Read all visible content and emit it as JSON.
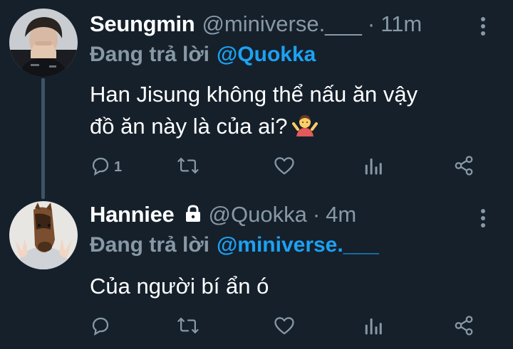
{
  "tweets": [
    {
      "display_name": "Seungmin",
      "handle": "@miniverse.___",
      "separator": "·",
      "time": "11m",
      "reply_prefix": "Đang trả lời",
      "reply_to": "@Quokka",
      "body_line1": "Han Jisung không thể nấu ăn vậy",
      "body_line2": "đồ ăn này là của ai?",
      "emoji": "person-shrugging-emoji",
      "reply_count": "1",
      "protected": false
    },
    {
      "display_name": "Hanniee",
      "handle": "@Quokka",
      "separator": "·",
      "time": "4m",
      "reply_prefix": "Đang trả lời",
      "reply_to": "@miniverse.___",
      "body_line1": "Của người bí ẩn ó",
      "protected": true
    }
  ],
  "icons": [
    "reply-icon",
    "retweet-icon",
    "like-icon",
    "analytics-icon",
    "share-icon",
    "more-icon",
    "lock-icon"
  ],
  "colors": {
    "background": "#15202b",
    "text": "#ffffff",
    "muted": "#8899a6",
    "accent": "#1da1f2",
    "thread_line": "#3d5466"
  }
}
